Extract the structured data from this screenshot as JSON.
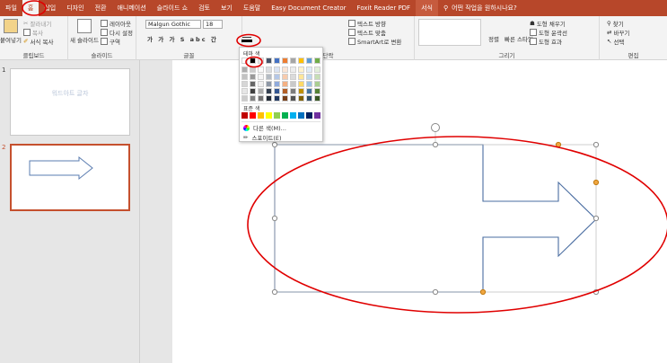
{
  "tabs": [
    {
      "label": "파일",
      "active": false
    },
    {
      "label": "홈",
      "active": true
    },
    {
      "label": "삽입",
      "active": false
    },
    {
      "label": "디자인",
      "active": false
    },
    {
      "label": "전환",
      "active": false
    },
    {
      "label": "애니메이션",
      "active": false
    },
    {
      "label": "슬라이드 쇼",
      "active": false
    },
    {
      "label": "검토",
      "active": false
    },
    {
      "label": "보기",
      "active": false
    },
    {
      "label": "도움말",
      "active": false
    },
    {
      "label": "Easy Document Creator",
      "active": false
    },
    {
      "label": "Foxit Reader PDF",
      "active": false
    },
    {
      "label": "서식",
      "active": false
    }
  ],
  "tell_me": "어떤 작업을 원하시나요?",
  "ribbon": {
    "clipboard": {
      "paste": "붙여넣기",
      "cut": "잘라내기",
      "copy": "복사",
      "format_painter": "서식 복사",
      "label": "클립보드"
    },
    "slides": {
      "new_slide": "새 슬라이드",
      "layout": "레이아웃",
      "reset": "다시 설정",
      "section": "구역",
      "label": "슬라이드"
    },
    "font": {
      "name": "Malgun Gothic",
      "size": "18",
      "label": "글꼴"
    },
    "paragraph": {
      "text_direction": "텍스트 방향",
      "align_text": "텍스트 맞춤",
      "smartart": "SmartArt로 변환",
      "label": "단락"
    },
    "drawing": {
      "arrange": "정렬",
      "quick_styles": "빠른 스타일",
      "shape_fill": "도형 채우기",
      "shape_outline": "도형 윤곽선",
      "shape_effects": "도형 효과",
      "label": "그리기"
    },
    "editing": {
      "find": "찾기",
      "replace": "바꾸기",
      "select": "선택",
      "label": "편집"
    }
  },
  "color_panel": {
    "theme_heading": "테마 색",
    "standard_heading": "표준 색",
    "more_colors": "다른 색(M)...",
    "eyedropper": "스포이트(E)",
    "theme_top_row": [
      "#ffffff",
      "#000000",
      "#e7e6e6",
      "#44546a",
      "#4472c4",
      "#ed7d31",
      "#a5a5a5",
      "#ffc000",
      "#5b9bd5",
      "#70ad47"
    ],
    "standard_colors": [
      "#c00000",
      "#ff0000",
      "#ffc000",
      "#ffff00",
      "#92d050",
      "#00b050",
      "#00b0f0",
      "#0070c0",
      "#002060",
      "#7030a0"
    ]
  },
  "slides": [
    {
      "number": "1",
      "text": "워드아트 글자"
    },
    {
      "number": "2",
      "text": ""
    }
  ]
}
